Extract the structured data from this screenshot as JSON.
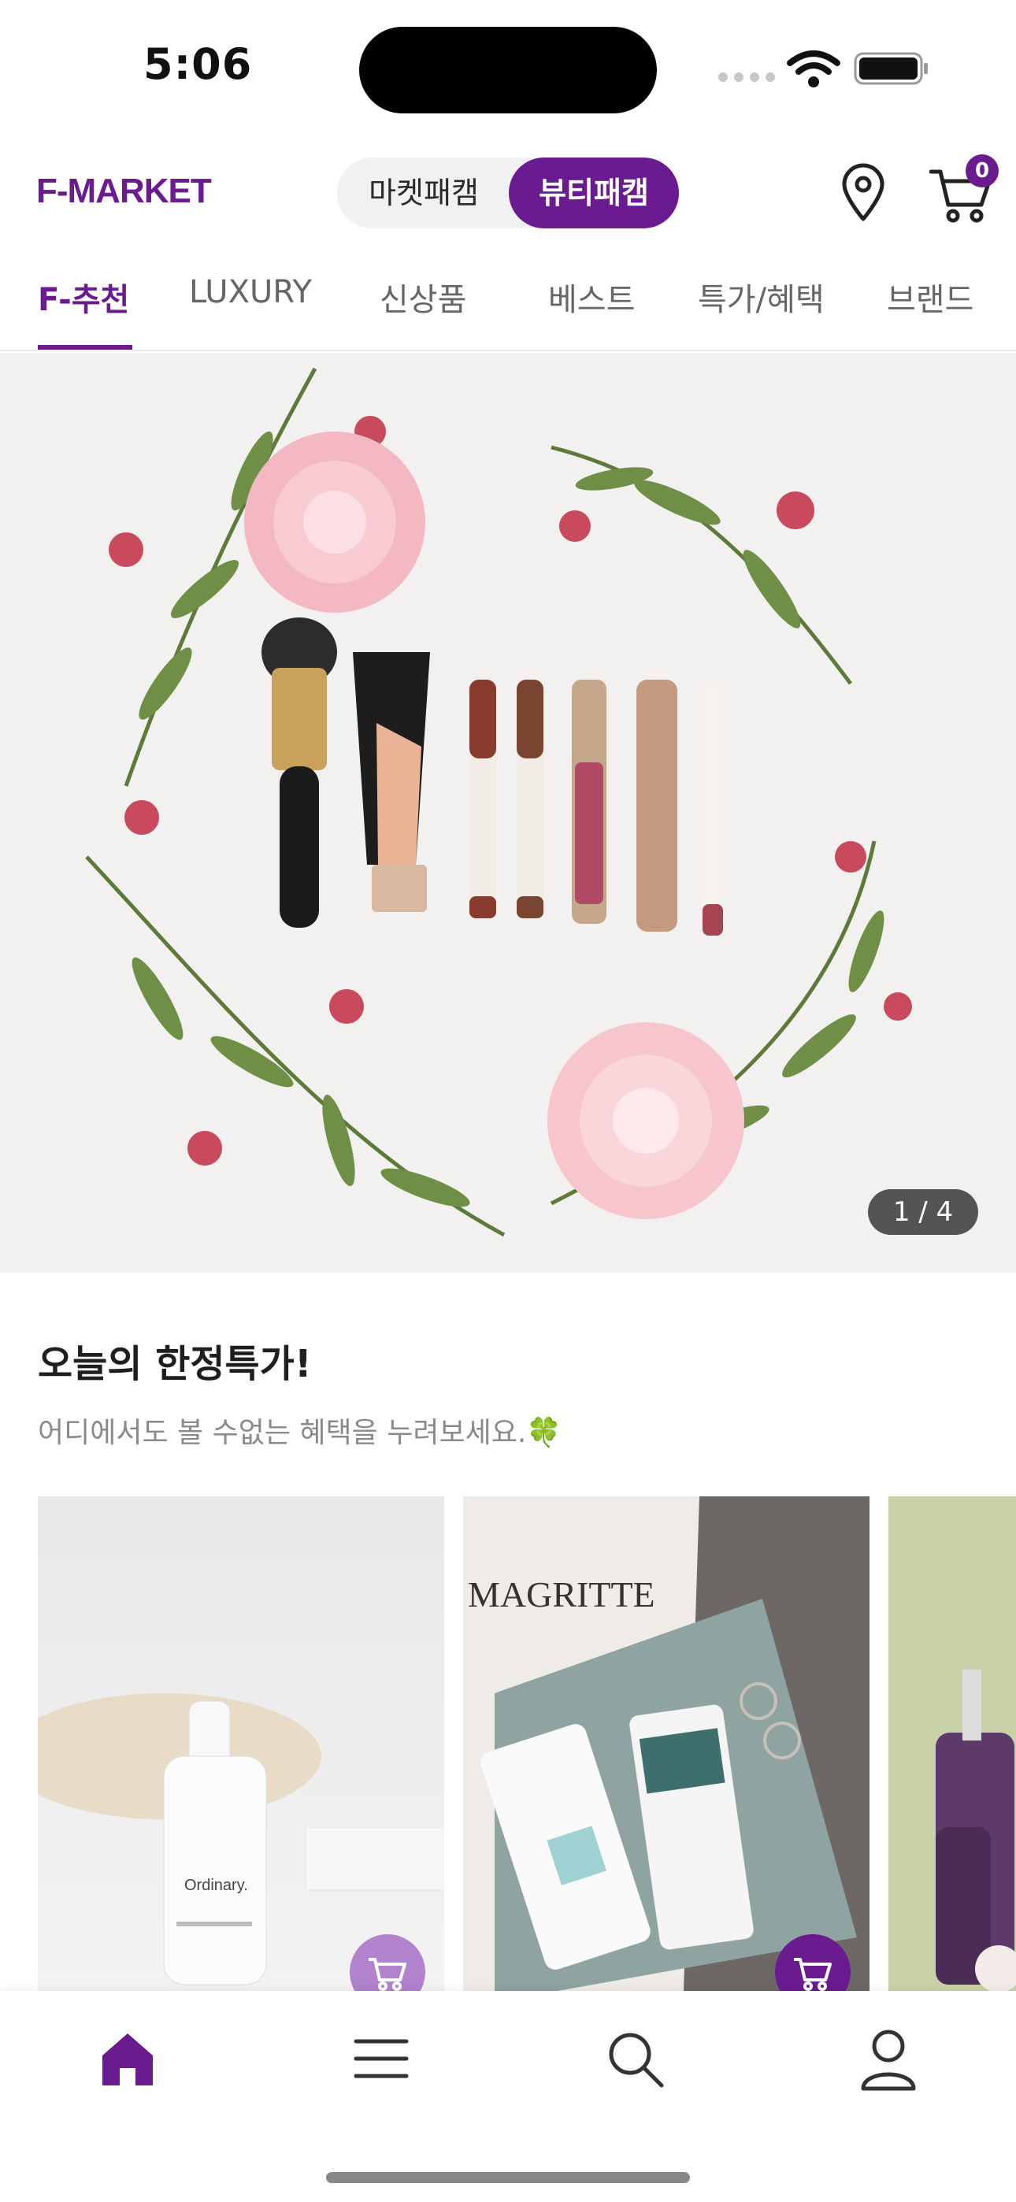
{
  "status": {
    "time": "5:06"
  },
  "header": {
    "logo": "F-MARKET",
    "segments": [
      "마켓패캠",
      "뷰티패캠"
    ],
    "active_segment": "뷰티패캠",
    "cart_count": "0",
    "icons": [
      "location-pin-icon",
      "cart-icon"
    ]
  },
  "tabs": [
    {
      "label": "F-추천",
      "active": true
    },
    {
      "label": "LUXURY"
    },
    {
      "label": "신상품"
    },
    {
      "label": "베스트"
    },
    {
      "label": "특가/혜택"
    },
    {
      "label": "브랜드"
    }
  ],
  "banner": {
    "pager": "1 / 4"
  },
  "deals": {
    "title": "오늘의 한정특가!",
    "subtitle": "어디에서도 볼 수없는 혜택을 누려보세요.🍀"
  },
  "bottom_nav": [
    "home-icon",
    "menu-icon",
    "search-icon",
    "user-icon"
  ],
  "colors": {
    "brand": "#6a1b8f",
    "brand_light": "#b083cc"
  }
}
